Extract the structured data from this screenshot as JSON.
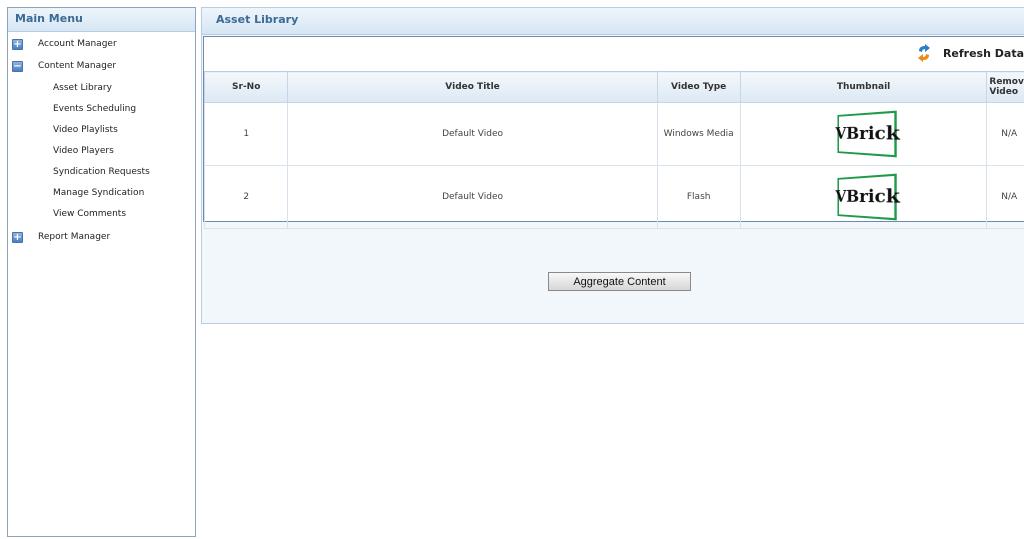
{
  "sidebar": {
    "title": "Main Menu",
    "groups": [
      {
        "label": "Account Manager",
        "toggle": "+"
      },
      {
        "label": "Content Manager",
        "toggle": "−"
      },
      {
        "label": "Report Manager",
        "toggle": "+"
      }
    ],
    "content_items": [
      "Asset Library",
      "Events Scheduling",
      "Video Playlists",
      "Video Players",
      "Syndication Requests",
      "Manage Syndication",
      "View Comments"
    ]
  },
  "main": {
    "title": "Asset Library",
    "refresh_label": "Refresh Data",
    "columns": [
      "Sr-No",
      "Video Title",
      "Video Type",
      "Thumbnail",
      "Remove Video"
    ],
    "rows": [
      {
        "sr": "1",
        "title": "Default Video",
        "type": "Windows Media",
        "thumb": "VBrick",
        "remove": "N/A"
      },
      {
        "sr": "2",
        "title": "Default Video",
        "type": "Flash",
        "thumb": "VBrick",
        "remove": "N/A"
      }
    ],
    "aggregate_label": "Aggregate Content"
  },
  "colors": {
    "accent": "#3b6a96",
    "border": "#8fa3bd",
    "logo_green": "#1f9a4a",
    "refresh_orange": "#f08a1c",
    "refresh_blue": "#2a7ccc"
  }
}
